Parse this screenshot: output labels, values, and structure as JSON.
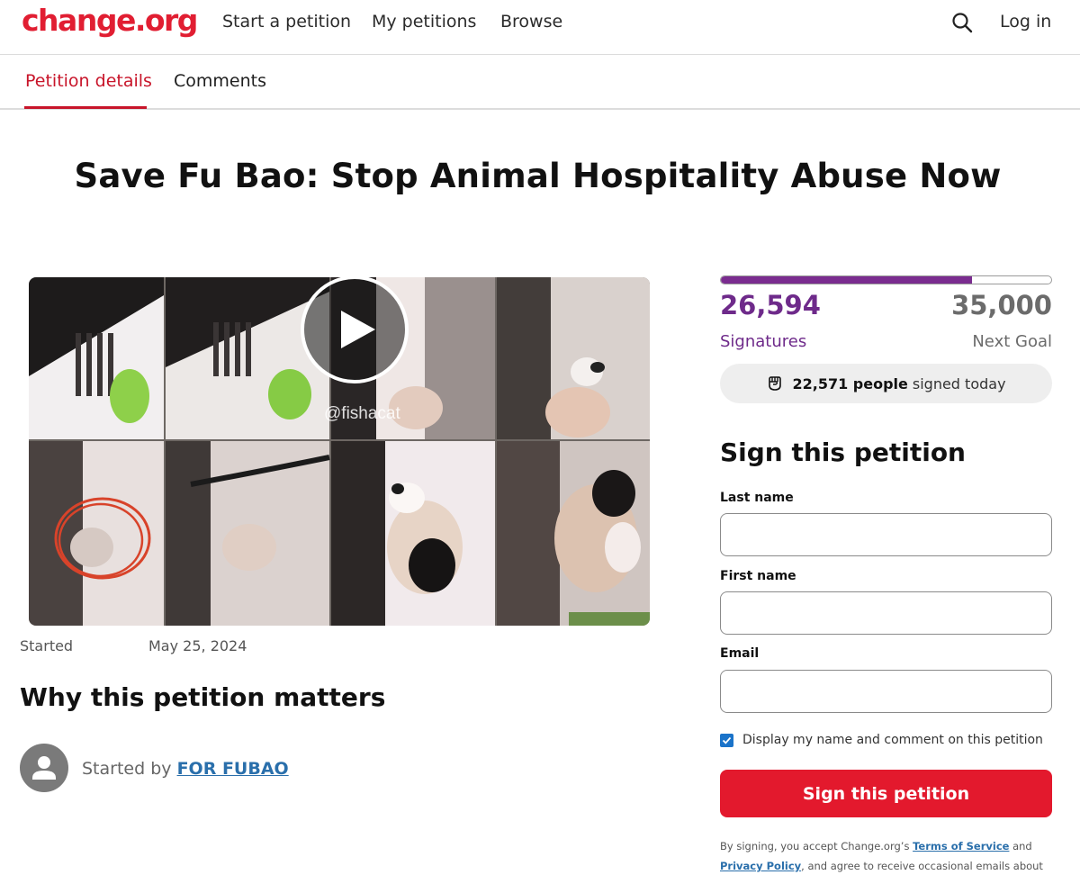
{
  "brand": {
    "logo": "change.org",
    "accent": "#e3192d",
    "purple": "#6e2a8a"
  },
  "nav": {
    "start_petition": "Start a petition",
    "my_petitions": "My petitions",
    "browse": "Browse",
    "search_icon": "search-icon",
    "login": "Log in"
  },
  "tabs": {
    "details": "Petition details",
    "comments": "Comments",
    "active": "details"
  },
  "petition": {
    "title": "Save Fu Bao: Stop Animal Hospitality Abuse Now",
    "media": {
      "watermark": "@fishacat",
      "play_icon": "play-icon"
    },
    "started_label": "Started",
    "started_date": "May 25, 2024",
    "why_heading": "Why this petition matters",
    "starter_prefix": "Started by",
    "starter_name": "FOR FUBAO"
  },
  "signatures": {
    "count": "26,594",
    "count_label": "Signatures",
    "goal": "35,000",
    "goal_label": "Next Goal",
    "progress_fraction": 0.76,
    "today_count": "22,571 people",
    "today_suffix": "signed today"
  },
  "form": {
    "heading": "Sign this petition",
    "last_name_label": "Last name",
    "last_name_value": "",
    "first_name_label": "First name",
    "first_name_value": "",
    "email_label": "Email",
    "email_value": "",
    "display_checkbox_label": "Display my name and comment on this petition",
    "display_checked": true,
    "submit": "Sign this petition"
  },
  "legal": {
    "prefix": "By signing, you accept Change.org’s",
    "tos": "Terms of Service",
    "and": "and",
    "privacy": "Privacy Policy",
    "suffix": ", and agree to receive occasional emails about"
  }
}
